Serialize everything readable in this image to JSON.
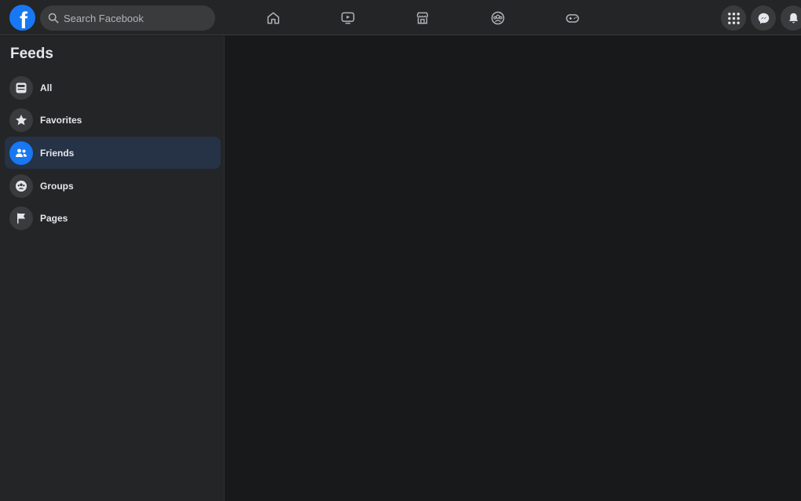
{
  "topbar": {
    "logo_letter": "f",
    "search": {
      "placeholder": "Search Facebook",
      "value": ""
    },
    "nav_icons": [
      "home-icon",
      "watch-icon",
      "marketplace-icon",
      "groups-icon",
      "gaming-icon"
    ],
    "right_icons": [
      "menu-grid-icon",
      "messenger-icon",
      "notifications-icon"
    ]
  },
  "sidebar": {
    "title": "Feeds",
    "items": [
      {
        "label": "All",
        "icon": "all-feed-icon",
        "active": false
      },
      {
        "label": "Favorites",
        "icon": "star-icon",
        "active": false
      },
      {
        "label": "Friends",
        "icon": "friends-icon",
        "active": true
      },
      {
        "label": "Groups",
        "icon": "groups-icon",
        "active": false
      },
      {
        "label": "Pages",
        "icon": "flag-icon",
        "active": false
      }
    ]
  },
  "colors": {
    "accent": "#1877f2",
    "topbar_bg": "#242526",
    "sidebar_bg": "#242526",
    "main_bg": "#18191a",
    "active_item_bg": "#263245"
  }
}
